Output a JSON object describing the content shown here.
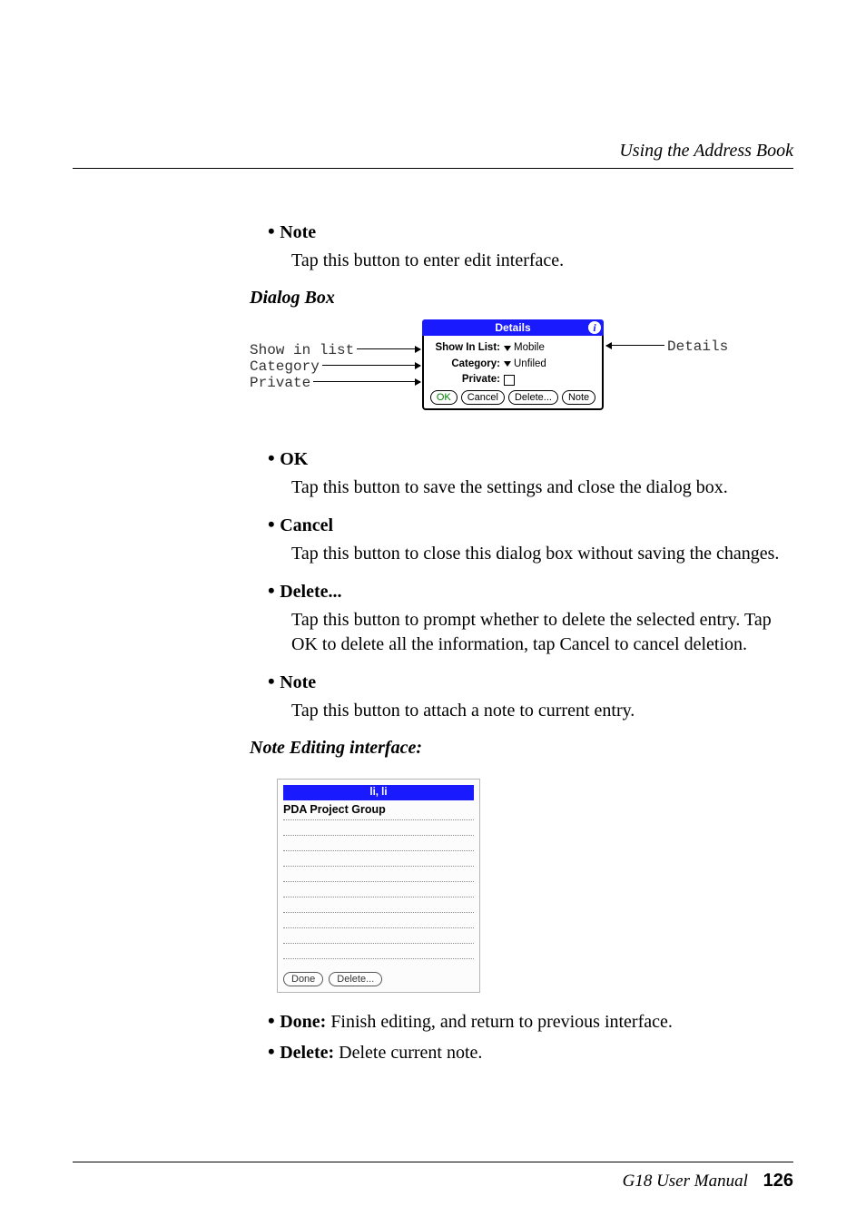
{
  "runningHead": "Using the Address Book",
  "top_list": {
    "note": {
      "label": "Note",
      "body": "Tap this button to enter edit interface."
    }
  },
  "dialog_box_heading": "Dialog Box",
  "callouts": {
    "show_in_list": "Show in list",
    "category": "Category",
    "private": "Private",
    "details": "Details"
  },
  "palm": {
    "title": "Details",
    "info_icon": "i",
    "rows": {
      "show_in_list": {
        "label": "Show In List:",
        "value": "Mobile"
      },
      "category": {
        "label": "Category:",
        "value": "Unfiled"
      },
      "private": {
        "label": "Private:"
      }
    },
    "buttons": {
      "ok": "OK",
      "cancel": "Cancel",
      "delete": "Delete...",
      "note": "Note"
    }
  },
  "dialog_items": {
    "ok": {
      "label": "OK",
      "body": "Tap this button to save the settings and close the dialog box."
    },
    "cancel": {
      "label": "Cancel",
      "body": "Tap this button to close this dialog box without saving the changes."
    },
    "delete": {
      "label": "Delete...",
      "body": "Tap this button to prompt whether to delete the selected entry. Tap OK to delete all the information, tap Cancel to cancel deletion."
    },
    "note": {
      "label": "Note",
      "body": "Tap this button to attach a note to current entry."
    }
  },
  "note_editing_heading": "Note Editing interface:",
  "note_window": {
    "title": "li, li",
    "content": "PDA Project Group",
    "buttons": {
      "done": "Done",
      "delete": "Delete..."
    }
  },
  "done_delete": {
    "done": {
      "label": "Done:",
      "body": " Finish editing, and return to previous interface."
    },
    "delete": {
      "label": "Delete:",
      "body": " Delete current note."
    }
  },
  "footer": {
    "manual": "G18 User Manual",
    "page": "126"
  }
}
